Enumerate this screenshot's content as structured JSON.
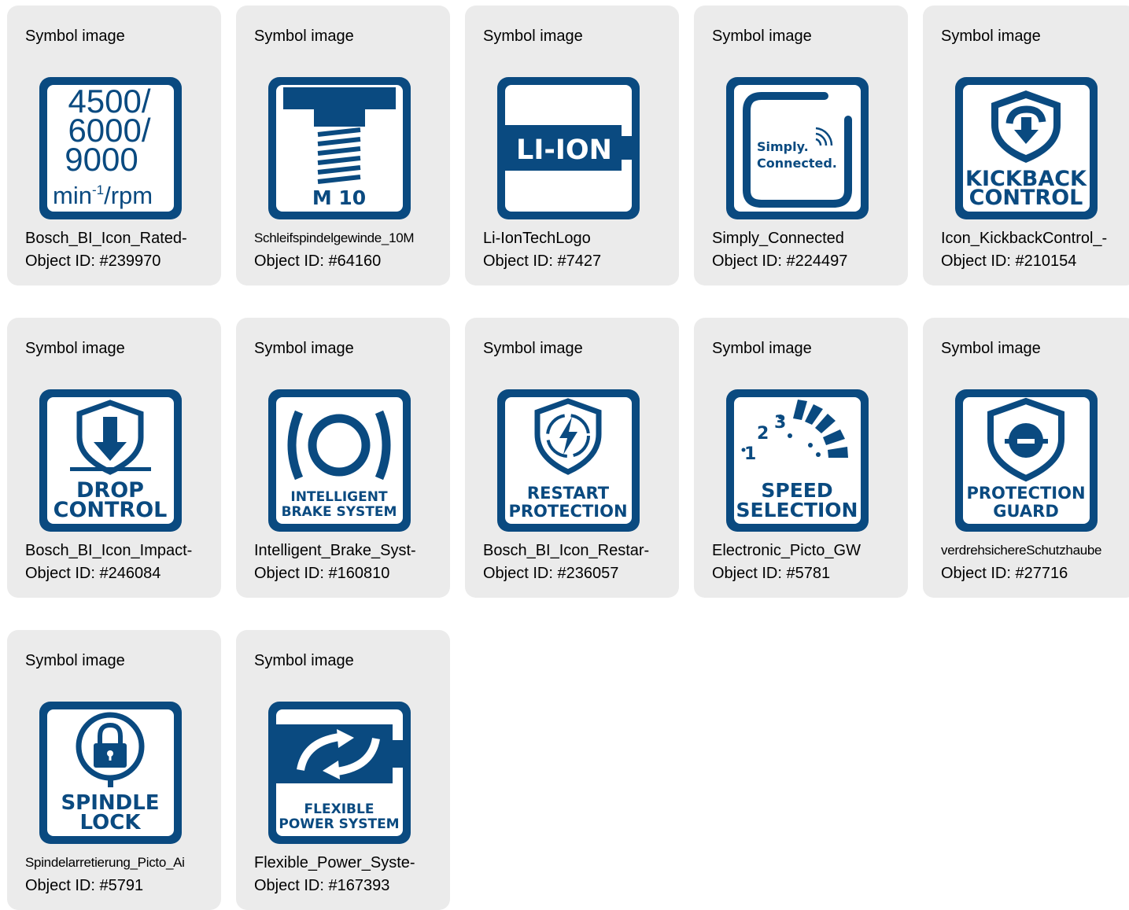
{
  "colors": {
    "icon_blue": "#0a4a80",
    "card_bg": "#ebebeb",
    "page_bg": "#ffffff"
  },
  "cards": [
    {
      "caption": "Symbol image",
      "name": "Bosch_BI_Icon_Rated-",
      "object_id": "Object ID: #239970",
      "icon": "rated-speed-icon",
      "icon_text": [
        "4500/",
        "6000/",
        "9000",
        "min",
        "-1",
        "/rpm"
      ]
    },
    {
      "caption": "Symbol image",
      "name": "Schleifspindelgewinde_10M",
      "object_id": "Object ID: #64160",
      "icon": "spindle-thread-icon",
      "icon_text": [
        "M 10"
      ]
    },
    {
      "caption": "Symbol image",
      "name": "Li-IonTechLogo",
      "object_id": "Object ID: #7427",
      "icon": "li-ion-battery-icon",
      "icon_text": [
        "LI-ION"
      ]
    },
    {
      "caption": "Symbol image",
      "name": "Simply_Connected",
      "object_id": "Object ID: #224497",
      "icon": "simply-connected-icon",
      "icon_text": [
        "Simply.",
        "Connected."
      ]
    },
    {
      "caption": "Symbol image",
      "name": "Icon_KickbackControl_-",
      "object_id": "Object ID: #210154",
      "icon": "kickback-control-icon",
      "icon_text": [
        "KICKBACK",
        "CONTROL"
      ]
    },
    {
      "caption": "Symbol image",
      "name": "Bosch_BI_Icon_Impact-",
      "object_id": "Object ID: #246084",
      "icon": "drop-control-icon",
      "icon_text": [
        "DROP",
        "CONTROL"
      ]
    },
    {
      "caption": "Symbol image",
      "name": "Intelligent_Brake_Syst-",
      "object_id": "Object ID: #160810",
      "icon": "intelligent-brake-icon",
      "icon_text": [
        "INTELLIGENT",
        "BRAKE SYSTEM"
      ]
    },
    {
      "caption": "Symbol image",
      "name": "Bosch_BI_Icon_Restar-",
      "object_id": "Object ID: #236057",
      "icon": "restart-protection-icon",
      "icon_text": [
        "RESTART",
        "PROTECTION"
      ]
    },
    {
      "caption": "Symbol image",
      "name": "Electronic_Picto_GW",
      "object_id": "Object ID: #5781",
      "icon": "speed-selection-icon",
      "icon_text": [
        "SPEED",
        "SELECTION",
        "1",
        "2",
        "3"
      ]
    },
    {
      "caption": "Symbol image",
      "name": "verdrehsichereSchutzhaube",
      "object_id": "Object ID: #27716",
      "icon": "protection-guard-icon",
      "icon_text": [
        "PROTECTION",
        "GUARD"
      ]
    },
    {
      "caption": "Symbol image",
      "name": "Spindelarretierung_Picto_Ai",
      "object_id": "Object ID: #5791",
      "icon": "spindle-lock-icon",
      "icon_text": [
        "SPINDLE",
        "LOCK"
      ]
    },
    {
      "caption": "Symbol image",
      "name": "Flexible_Power_Syste-",
      "object_id": "Object ID: #167393",
      "icon": "flexible-power-icon",
      "icon_text": [
        "FLEXIBLE",
        "POWER SYSTEM"
      ]
    }
  ]
}
